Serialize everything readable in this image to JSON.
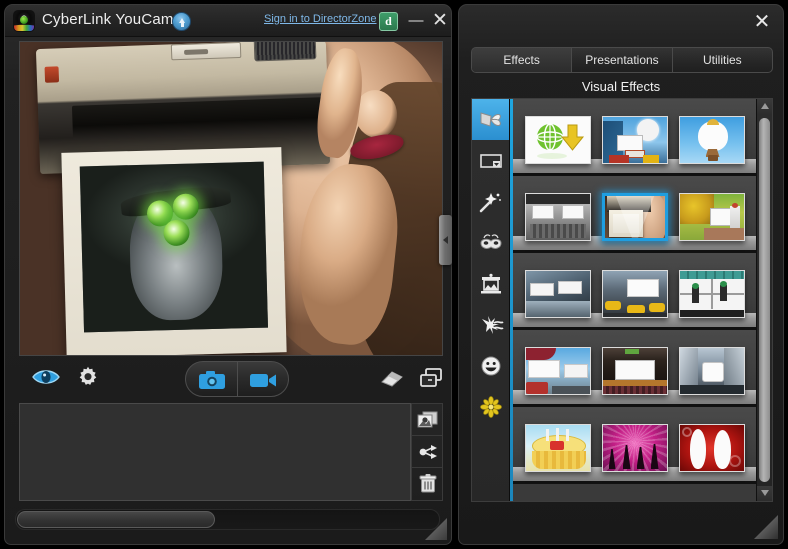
{
  "app": {
    "title": "CyberLink YouCam",
    "logo_icon": "youcam-logo",
    "upload_icon": "upload-arrow-icon",
    "signin_link": "Sign in to DirectorZone",
    "directorzone_badge": "d",
    "minimize_label": "—",
    "close_label": "✕"
  },
  "preview": {
    "effect_applied": "Instant Camera / Polaroid frame",
    "scene_description": "Webcam feed: woman holding an instant camera with a printed photo emerging"
  },
  "toolbar": {
    "buttons": [
      {
        "name": "face-login-eye",
        "icon": "eye-icon"
      },
      {
        "name": "settings",
        "icon": "gear-icon"
      },
      {
        "name": "capture-photo",
        "icon": "camera-icon"
      },
      {
        "name": "record-video",
        "icon": "video-camera-icon"
      },
      {
        "name": "clear-effects",
        "icon": "eraser-icon"
      },
      {
        "name": "dual-preview",
        "icon": "dual-window-icon"
      }
    ]
  },
  "tray": {
    "empty": true,
    "side_buttons": [
      {
        "name": "import-media",
        "icon": "photo-import-icon"
      },
      {
        "name": "share",
        "icon": "share-icon"
      },
      {
        "name": "delete",
        "icon": "trash-icon"
      }
    ],
    "scrollbar": {
      "name": "tray-horizontal-scrollbar",
      "thumb_fraction": 0.47
    }
  },
  "effects_panel": {
    "close_label": "✕",
    "tabs": [
      {
        "label": "Effects",
        "selected": true
      },
      {
        "label": "Presentations",
        "selected": false
      },
      {
        "label": "Utilities",
        "selected": false
      }
    ],
    "section_title": "Visual Effects",
    "categories": [
      {
        "name": "all-effects",
        "icon": "butterfly-icon",
        "selected": true
      },
      {
        "name": "frames",
        "icon": "frame-icon",
        "selected": false
      },
      {
        "name": "particles",
        "icon": "magic-wand-icon",
        "selected": false
      },
      {
        "name": "distortions",
        "icon": "mask-icon",
        "selected": false
      },
      {
        "name": "scenes",
        "icon": "theater-icon",
        "selected": false
      },
      {
        "name": "filters",
        "icon": "splash-icon",
        "selected": false
      },
      {
        "name": "emotions",
        "icon": "smiley-icon",
        "selected": false
      },
      {
        "name": "gadgets",
        "icon": "flower-icon",
        "selected": false
      }
    ],
    "rows": [
      {
        "items": [
          {
            "name": "download-more-effects",
            "kind": "download",
            "selected": false
          },
          {
            "name": "billboard-sky-frame",
            "kind": "billboard-sky",
            "selected": false
          },
          {
            "name": "hot-air-balloon-frame",
            "kind": "balloon",
            "selected": false
          }
        ]
      },
      {
        "items": [
          {
            "name": "station-bw-frame",
            "kind": "station-bw",
            "selected": false
          },
          {
            "name": "instant-camera-frame",
            "kind": "instant-camera",
            "selected": true
          },
          {
            "name": "autumn-billboard-frame",
            "kind": "autumn",
            "selected": false
          }
        ]
      },
      {
        "items": [
          {
            "name": "subway-platform-frame",
            "kind": "subway",
            "selected": false
          },
          {
            "name": "taxi-street-frame",
            "kind": "taxi",
            "selected": false
          },
          {
            "name": "window-washers-frame",
            "kind": "washers",
            "selected": false
          }
        ]
      },
      {
        "items": [
          {
            "name": "piccadilly-frame",
            "kind": "piccadilly",
            "selected": false
          },
          {
            "name": "cinema-stage-frame",
            "kind": "cinema",
            "selected": false
          },
          {
            "name": "times-square-frame",
            "kind": "times-square",
            "selected": false
          }
        ]
      },
      {
        "items": [
          {
            "name": "birthday-cake-frame",
            "kind": "cake",
            "selected": false
          },
          {
            "name": "party-dancers-frame",
            "kind": "party",
            "selected": false
          },
          {
            "name": "romance-frame",
            "kind": "romance",
            "selected": false
          }
        ]
      }
    ],
    "vscroll": {
      "name": "effects-vertical-scrollbar",
      "up_arrow": "▲",
      "down_arrow": "▼"
    }
  },
  "collapse_handle": {
    "name": "panel-collapse-handle",
    "icon": "chevron-left-icon"
  },
  "colors": {
    "accent_blue": "#1f9ee0",
    "window_bg": "#1f1f1f",
    "titlebar": "#2a2a2a",
    "shelf": "#3f3f3f",
    "text": "#e8e8e8",
    "link": "#7fb8e8"
  }
}
